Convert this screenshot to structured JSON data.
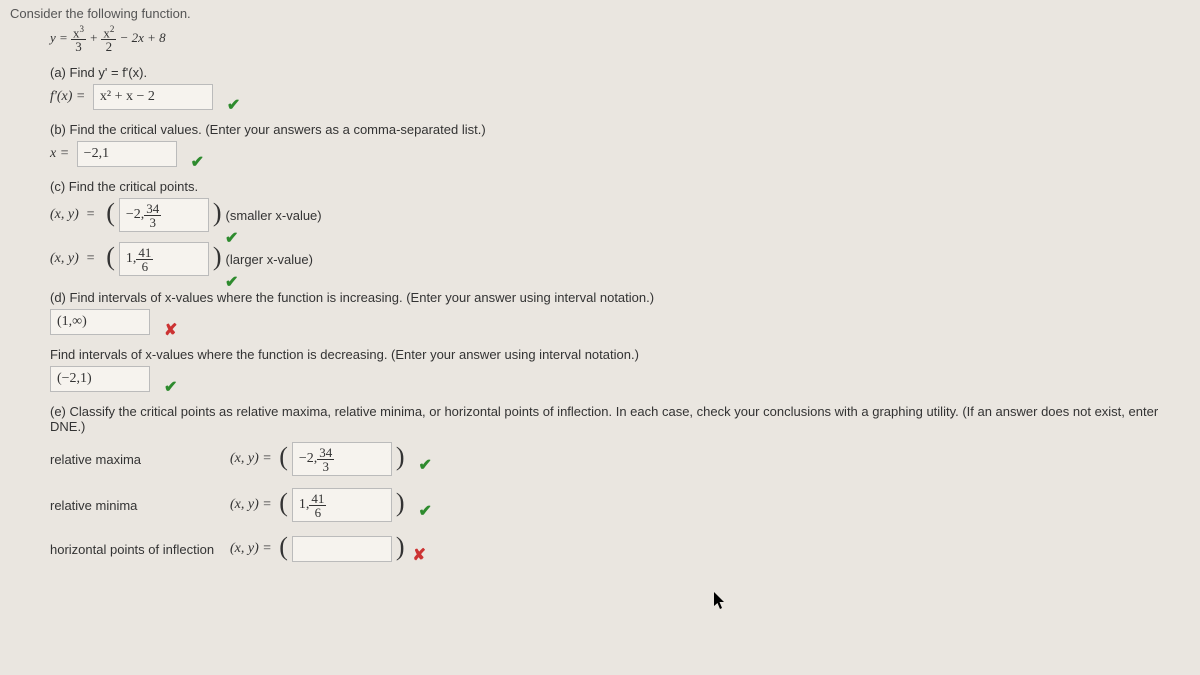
{
  "header": "Consider the following function.",
  "equation_html": "y = <span class='frac'><span class='num'>x<sup>3</sup></span><span class='den'>3</span></span> + <span class='frac'><span class='num'>x<sup>2</sup></span><span class='den'>2</span></span> − 2x + 8",
  "a": {
    "prompt": "(a) Find y' = f'(x).",
    "lhs": "f'(x) = ",
    "answer": "x² + x − 2"
  },
  "b": {
    "prompt": "(b) Find the critical values. (Enter your answers as a comma-separated list.)",
    "lhs": "x = ",
    "answer": "−2,1"
  },
  "c": {
    "prompt": "(c) Find the critical points.",
    "lhs": "(x, y)  =  ",
    "ans1_html": "−2, <span class='frac'><span class='num'>34</span><span class='den'>3</span></span>",
    "hint1": " (smaller x-value)",
    "ans2_html": "1, <span class='frac'><span class='num'>41</span><span class='den'>6</span></span>",
    "hint2": " (larger x-value)"
  },
  "d": {
    "prompt1": "(d) Find intervals of x-values where the function is increasing. (Enter your answer using interval notation.)",
    "ans1": "(1,∞)",
    "prompt2": "Find intervals of x-values where the function is decreasing. (Enter your answer using interval notation.)",
    "ans2": "(−2,1)"
  },
  "e": {
    "prompt": "(e) Classify the critical points as relative maxima, relative minima, or horizontal points of inflection. In each case, check your conclusions with a graphing utility. (If an answer does not exist, enter DNE.)",
    "row1_label": "relative maxima",
    "row1_ans_html": "−2, <span class='frac'><span class='num'>34</span><span class='den'>3</span></span>",
    "row2_label": "relative minima",
    "row2_ans_html": "1, <span class='frac'><span class='num'>41</span><span class='den'>6</span></span>",
    "row3_label": "horizontal points of inflection",
    "xy_lhs": "(x, y) = "
  },
  "marks": {
    "check": "✔",
    "cross": "✘"
  }
}
